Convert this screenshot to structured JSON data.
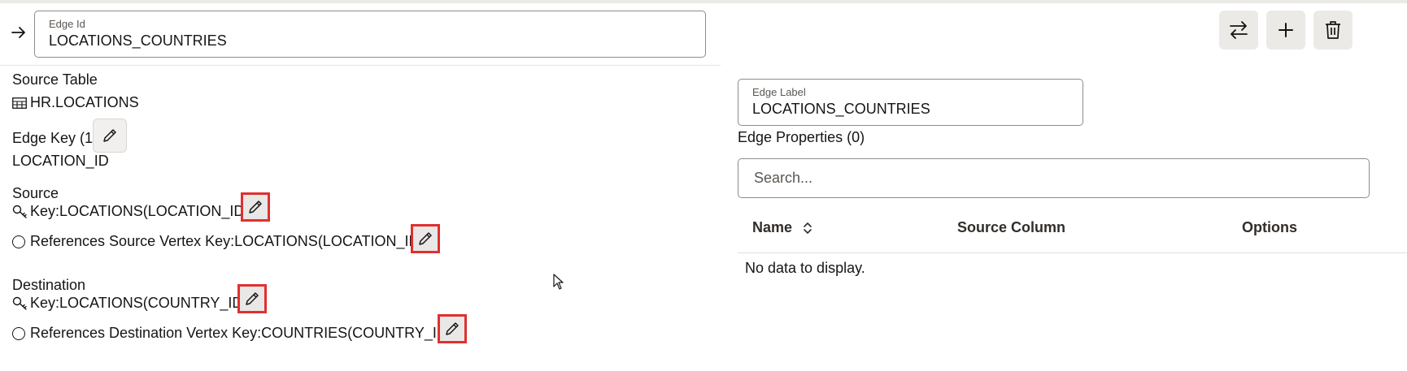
{
  "edge_id": {
    "label": "Edge Id",
    "value": "LOCATIONS_COUNTRIES"
  },
  "toolbar": {
    "swap_icon": "swap-arrows-icon",
    "add_icon": "plus-icon",
    "delete_icon": "trash-icon"
  },
  "source_table": {
    "heading": "Source Table",
    "value": "HR.LOCATIONS",
    "icon": "table-icon"
  },
  "edge_key": {
    "heading": "Edge Key (1)",
    "value": "LOCATION_ID"
  },
  "source": {
    "heading": "Source",
    "key": "Key:LOCATIONS(LOCATION_ID)",
    "references": "References Source Vertex Key:LOCATIONS(LOCATION_ID)"
  },
  "destination": {
    "heading": "Destination",
    "key": "Key:LOCATIONS(COUNTRY_ID)",
    "references": "References Destination Vertex Key:COUNTRIES(COUNTRY_ID)"
  },
  "edge_label": {
    "label": "Edge Label",
    "value": "LOCATIONS_COUNTRIES"
  },
  "edge_properties": {
    "heading": "Edge Properties (0)",
    "search_placeholder": "Search...",
    "columns": [
      "Name",
      "Source Column",
      "Options"
    ],
    "empty_text": "No data to display."
  },
  "colors": {
    "highlight": "#e03030",
    "button_bg": "#ebeae7"
  }
}
